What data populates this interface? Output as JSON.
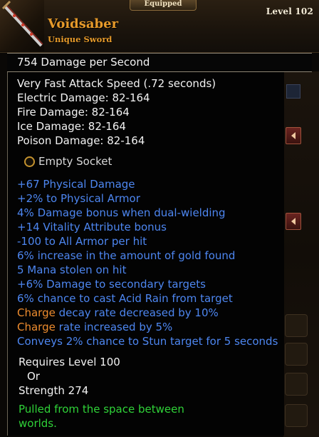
{
  "header": {
    "equipped_tab": "Equipped",
    "level": "Level 102",
    "item_name": "Voidsaber",
    "item_type": "Unique Sword"
  },
  "dps": "754  Damage per Second",
  "base_stats": [
    "Very Fast Attack Speed (.72 seconds)",
    "Electric Damage: 82-164",
    "Fire Damage: 82-164",
    "Ice Damage: 82-164",
    "Poison Damage: 82-164"
  ],
  "socket": "Empty Socket",
  "affixes": [
    "+67 Physical Damage",
    "+2% to Physical Armor",
    "4% Damage bonus when dual-wielding",
    "+14 Vitality Attribute bonus",
    "-100 to All Armor per hit",
    "6% increase in the amount of gold found",
    "5 Mana stolen on hit",
    "+6% Damage to secondary targets",
    "6% chance to cast Acid Rain from target"
  ],
  "charge_lines": [
    {
      "keyword": "Charge",
      "rest": " decay rate decreased by 10%"
    },
    {
      "keyword": "Charge",
      "rest": " rate increased by 5%"
    }
  ],
  "convey_line": "Conveys 2% chance to Stun target for 5 seconds",
  "requirements": {
    "level": "Requires Level 100",
    "or": "Or",
    "strength": "Strength 274"
  },
  "flavor": [
    "Pulled from the space between",
    "worlds."
  ],
  "colors": {
    "name": "#e69a2a",
    "affix": "#4d86f0",
    "charge": "#ee8c2e",
    "flavor": "#2fd238"
  }
}
